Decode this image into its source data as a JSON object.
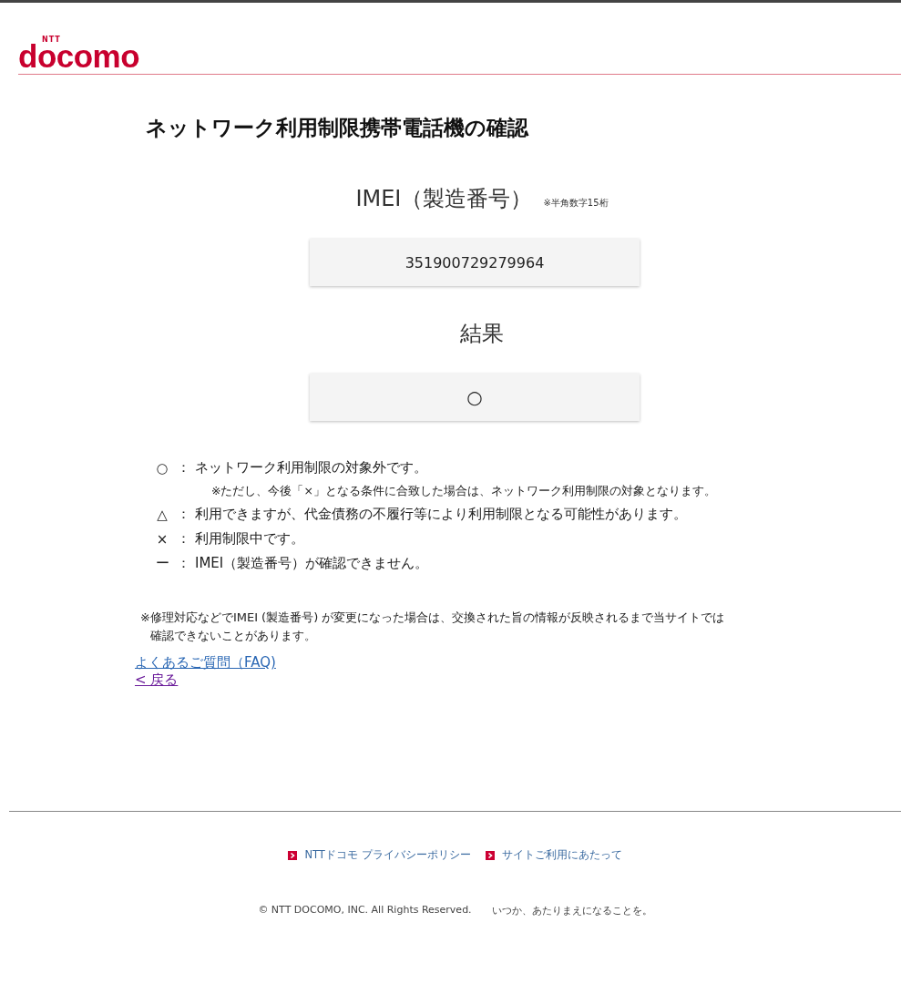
{
  "logo": {
    "brand": "docomo",
    "prefix": "NTT"
  },
  "title": "ネットワーク利用制限携帯電話機の確認",
  "imei": {
    "label": "IMEI（製造番号）",
    "hint": "※半角数字15桁",
    "value": "351900729279964"
  },
  "result": {
    "label": "結果",
    "value": "○"
  },
  "legend": [
    {
      "symbol": "○",
      "sep": "：",
      "text": "ネットワーク利用制限の対象外です。",
      "note": "※ただし、今後「×」となる条件に合致した場合は、ネットワーク利用制限の対象となります。"
    },
    {
      "symbol": "△",
      "sep": "：",
      "text": "利用できますが、代金債務の不履行等により利用制限となる可能性があります。"
    },
    {
      "symbol": "×",
      "sep": "：",
      "text": "利用制限中です。"
    },
    {
      "symbol": "ー",
      "sep": "：",
      "text": "IMEI（製造番号）が確認できません。"
    }
  ],
  "notice": [
    "※修理対応などでIMEI (製造番号) が変更になった場合は、交換された旨の情報が反映されるまで当サイトでは",
    "確認できないことがあります。"
  ],
  "links": [
    {
      "text": "よくあるご質問（FAQ)",
      "visited": false
    },
    {
      "text": "< 戻る",
      "visited": true
    }
  ],
  "footer": {
    "links": [
      "NTTドコモ プライバシーポリシー",
      "サイトご利用にあたって"
    ],
    "copyright": "© NTT DOCOMO, INC. All Rights Reserved.",
    "slogan": "いつか、あたりまえになることを。"
  }
}
